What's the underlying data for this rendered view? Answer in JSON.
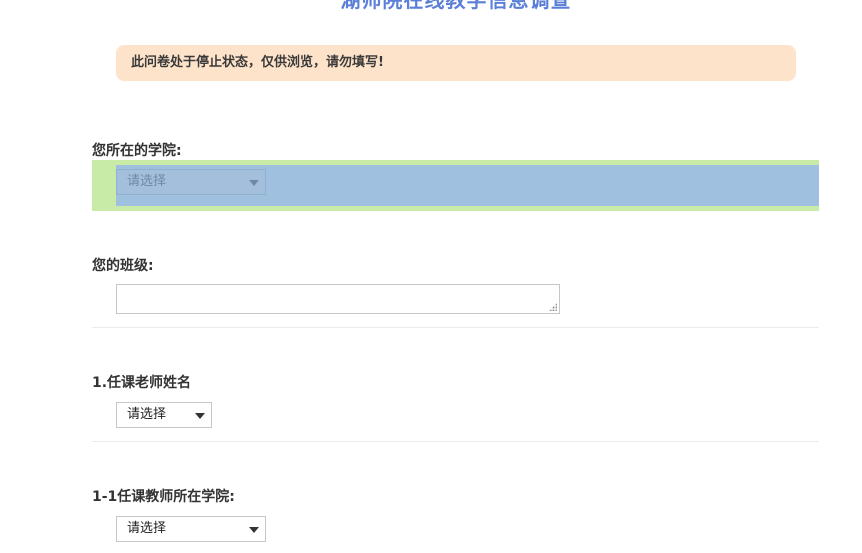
{
  "survey": {
    "title": "湖师院在线教学信息调查",
    "notice": "此问卷处于停止状态，仅供浏览，请勿填写!"
  },
  "questions": [
    {
      "label": "您所在的学院:",
      "type": "select",
      "value": "请选择",
      "highlighted": true
    },
    {
      "label": "您的班级:",
      "type": "textarea",
      "value": ""
    },
    {
      "label": "1.任课老师姓名",
      "type": "select",
      "value": "请选择"
    },
    {
      "label": "1-1任课教师所在学院:",
      "type": "select",
      "value": "请选择"
    }
  ],
  "colors": {
    "title": "#5b7fd9",
    "notice_bg": "#fde3c9",
    "highlight_outer": "#c8eba8",
    "highlight_inner": "#9fc0df"
  }
}
